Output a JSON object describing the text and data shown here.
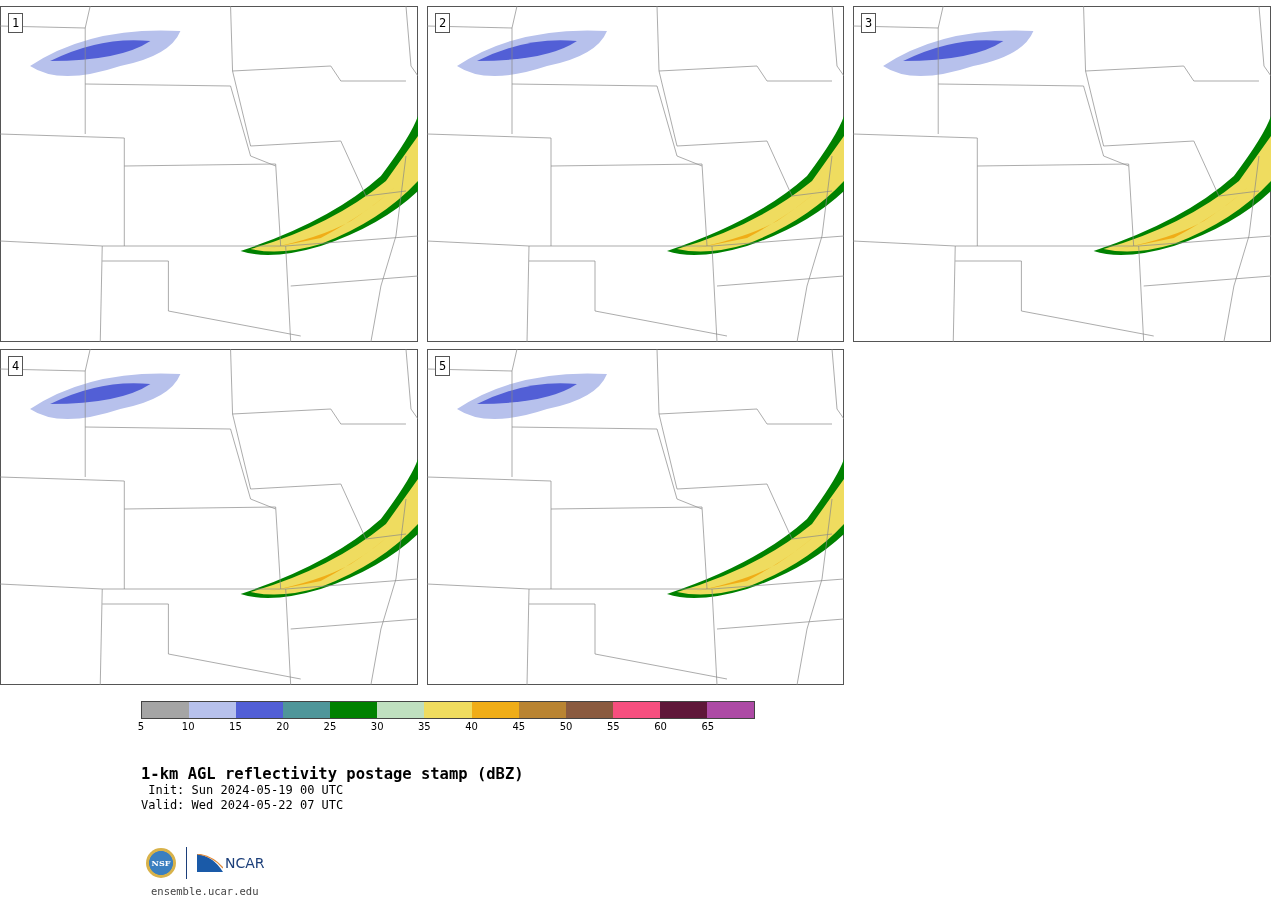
{
  "panels": [
    {
      "label": "1"
    },
    {
      "label": "2"
    },
    {
      "label": "3"
    },
    {
      "label": "4"
    },
    {
      "label": "5"
    }
  ],
  "colorbar": {
    "bins": [
      {
        "color": "#a5a5a5"
      },
      {
        "color": "#b7c1ec"
      },
      {
        "color": "#525fd6"
      },
      {
        "color": "#4f969a"
      },
      {
        "color": "#008100"
      },
      {
        "color": "#bfdfbf"
      },
      {
        "color": "#efdc5f"
      },
      {
        "color": "#f0ad17"
      },
      {
        "color": "#b98432"
      },
      {
        "color": "#8a5a3f"
      },
      {
        "color": "#f64f7f"
      },
      {
        "color": "#5f1739"
      },
      {
        "color": "#ad4aa5"
      }
    ],
    "ticks": [
      "5",
      "10",
      "15",
      "20",
      "25",
      "30",
      "35",
      "40",
      "45",
      "50",
      "55",
      "60",
      "65"
    ]
  },
  "title": "1-km AGL reflectivity postage stamp (dBZ)",
  "init": " Init: Sun 2024-05-19 00 UTC",
  "valid": "Valid: Wed 2024-05-22 07 UTC",
  "logo": {
    "seal": "NSF",
    "name": "NCAR"
  },
  "site": "ensemble.ucar.edu"
}
